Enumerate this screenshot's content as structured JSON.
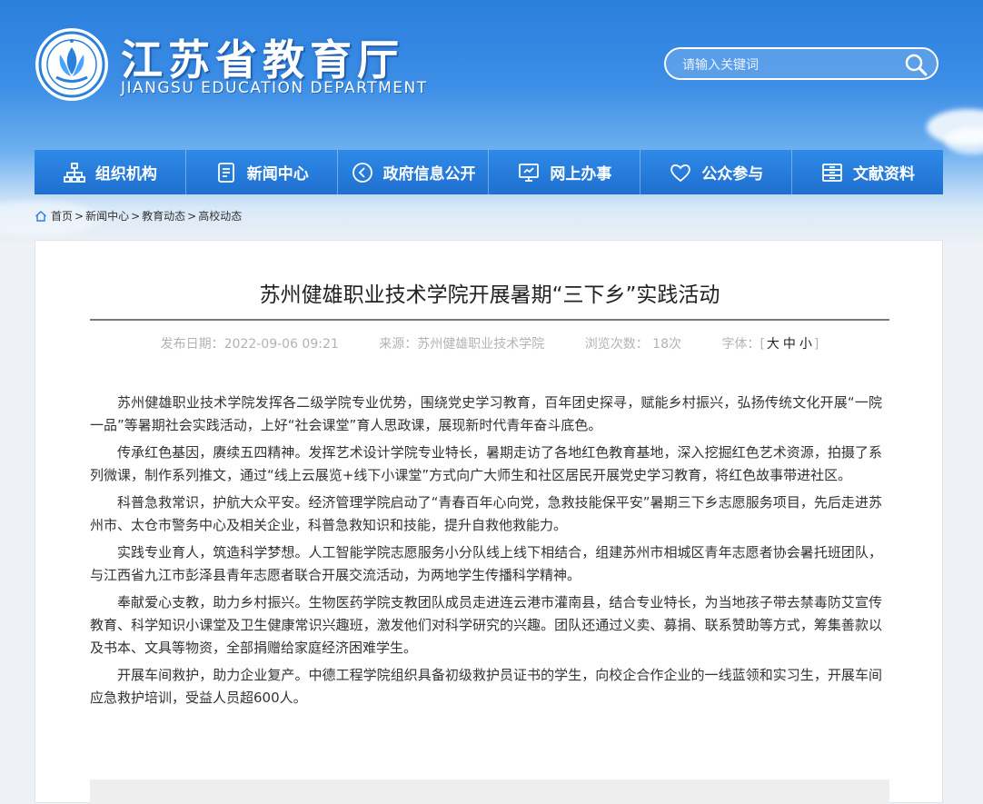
{
  "header": {
    "title": "江苏省教育厅",
    "subtitle": "JIANGSU EDUCATION DEPARTMENT",
    "logo_icon": "education-seal-logo",
    "search_placeholder": "请输入关键词",
    "search_icon": "search-icon"
  },
  "nav": {
    "items": [
      {
        "label": "组织机构",
        "icon": "org-chart-icon"
      },
      {
        "label": "新闻中心",
        "icon": "document-icon"
      },
      {
        "label": "政府信息公开",
        "icon": "announce-icon"
      },
      {
        "label": "网上办事",
        "icon": "monitor-icon"
      },
      {
        "label": "公众参与",
        "icon": "heart-icon"
      },
      {
        "label": "文献资料",
        "icon": "archive-icon"
      }
    ]
  },
  "breadcrumb": {
    "items": [
      "首页",
      "新闻中心",
      "教育动态",
      "高校动态"
    ],
    "separator": ">"
  },
  "article": {
    "title": "苏州健雄职业技术学院开展暑期“三下乡”实践活动",
    "meta": {
      "date_label": "发布日期：",
      "date": "2022-09-06 09:21",
      "source_label": "来源：",
      "source": "苏州健雄职业技术学院",
      "views_label": "浏览次数：",
      "views": "18次",
      "font_label": "字体：",
      "bracket_open": "[",
      "bracket_close": "]",
      "font_sizes": [
        "大",
        "中",
        "小"
      ]
    },
    "paragraphs": [
      "苏州健雄职业技术学院发挥各二级学院专业优势，围绕党史学习教育，百年团史探寻，赋能乡村振兴，弘扬传统文化开展“一院一品”等暑期社会实践活动，上好“社会课堂”育人思政课，展现新时代青年奋斗底色。",
      "传承红色基因，赓续五四精神。发挥艺术设计学院专业特长，暑期走访了各地红色教育基地，深入挖掘红色艺术资源，拍摄了系列微课，制作系列推文，通过“线上云展览+线下小课堂”方式向广大师生和社区居民开展党史学习教育，将红色故事带进社区。",
      "科普急救常识，护航大众平安。经济管理学院启动了“青春百年心向党，急救技能保平安”暑期三下乡志愿服务项目，先后走进苏州市、太仓市警务中心及相关企业，科普急救知识和技能，提升自救他救能力。",
      "实践专业育人，筑造科学梦想。人工智能学院志愿服务小分队线上线下相结合，组建苏州市相城区青年志愿者协会暑托班团队，与江西省九江市彭泽县青年志愿者联合开展交流活动，为两地学生传播科学精神。",
      "奉献爱心支教，助力乡村振兴。生物医药学院支教团队成员走进连云港市灌南县，结合专业特长，为当地孩子带去禁毒防艾宣传教育、科学知识小课堂及卫生健康常识兴趣班，激发他们对科学研究的兴趣。团队还通过义卖、募捐、联系赞助等方式，筹集善款以及书本、文具等物资，全部捐赠给家庭经济困难学生。",
      "开展车间救护，助力企业复产。中德工程学院组织具备初级救护员证书的学生，向校企合作企业的一线蓝领和实习生，开展车间应急救护培训，受益人员超600人。"
    ]
  },
  "colors": {
    "header_top": "#2b7fdd",
    "nav_bg": "#1f6fd0",
    "text": "#333333",
    "meta_text": "#b3b3b3"
  }
}
